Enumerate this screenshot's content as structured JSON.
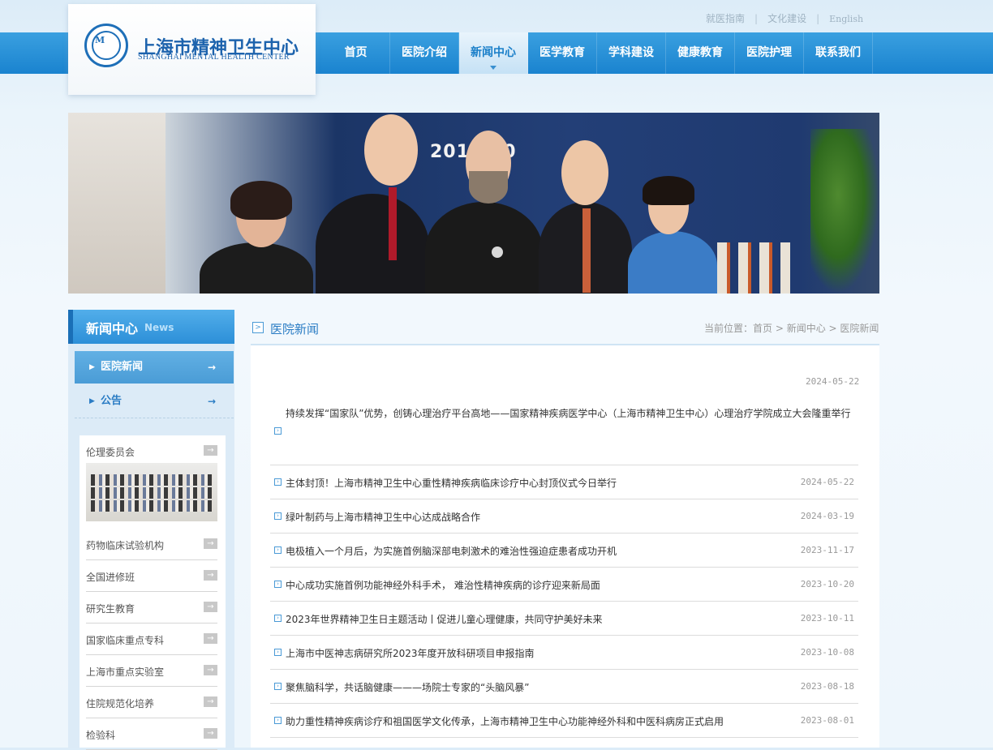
{
  "header": {
    "top_links": [
      "就医指南",
      "文化建设",
      "English"
    ],
    "logo_cn": "上海市精神卫生中心",
    "logo_en": "SHANGHAI MENTAL HEALTH CENTER"
  },
  "nav": {
    "items": [
      "首页",
      "医院介绍",
      "新闻中心",
      "医学教育",
      "学科建设",
      "健康教育",
      "医院护理",
      "联系我们"
    ],
    "active": "新闻中心"
  },
  "banner": {
    "text": "2013 30"
  },
  "sidebar": {
    "title_cn": "新闻中心",
    "title_en": "News",
    "subnav": [
      "医院新闻",
      "公告"
    ],
    "links": [
      "伦理委员会",
      "药物临床试验机构",
      "全国进修班",
      "研究生教育",
      "国家临床重点专科",
      "上海市重点实验室",
      "住院规范化培养",
      "检验科"
    ]
  },
  "main": {
    "title": "医院新闻",
    "breadcrumb_label": "当前位置：",
    "breadcrumb": [
      "首页",
      "新闻中心",
      "医院新闻"
    ],
    "news": [
      {
        "title": "持续发挥“国家队”优势，创铸心理治疗平台高地——国家精神疾病医学中心（上海市精神卫生中心）心理治疗学院成立大会隆重举行",
        "date": "2024-05-22"
      },
      {
        "title": "主体封顶！上海市精神卫生中心重性精神疾病临床诊疗中心封顶仪式今日举行",
        "date": "2024-05-22"
      },
      {
        "title": "绿叶制药与上海市精神卫生中心达成战略合作",
        "date": "2024-03-19"
      },
      {
        "title": "电极植入一个月后，为实施首例脑深部电刺激术的难治性强迫症患者成功开机",
        "date": "2023-11-17"
      },
      {
        "title": "中心成功实施首例功能神经外科手术， 难治性精神疾病的诊疗迎来新局面",
        "date": "2023-10-20"
      },
      {
        "title": "2023年世界精神卫生日主题活动丨促进儿童心理健康，共同守护美好未来",
        "date": "2023-10-11"
      },
      {
        "title": "上海市中医神志病研究所2023年度开放科研项目申报指南",
        "date": "2023-10-08"
      },
      {
        "title": "聚焦脑科学，共话脑健康———场院士专家的“头脑风暴”",
        "date": "2023-08-18"
      },
      {
        "title": "助力重性精神疾病诊疗和祖国医学文化传承，上海市精神卫生中心功能神经外科和中医科病房正式启用",
        "date": "2023-08-01"
      }
    ]
  },
  "colors": {
    "nav": "#1a83cf",
    "accent": "#2a7cc4"
  }
}
